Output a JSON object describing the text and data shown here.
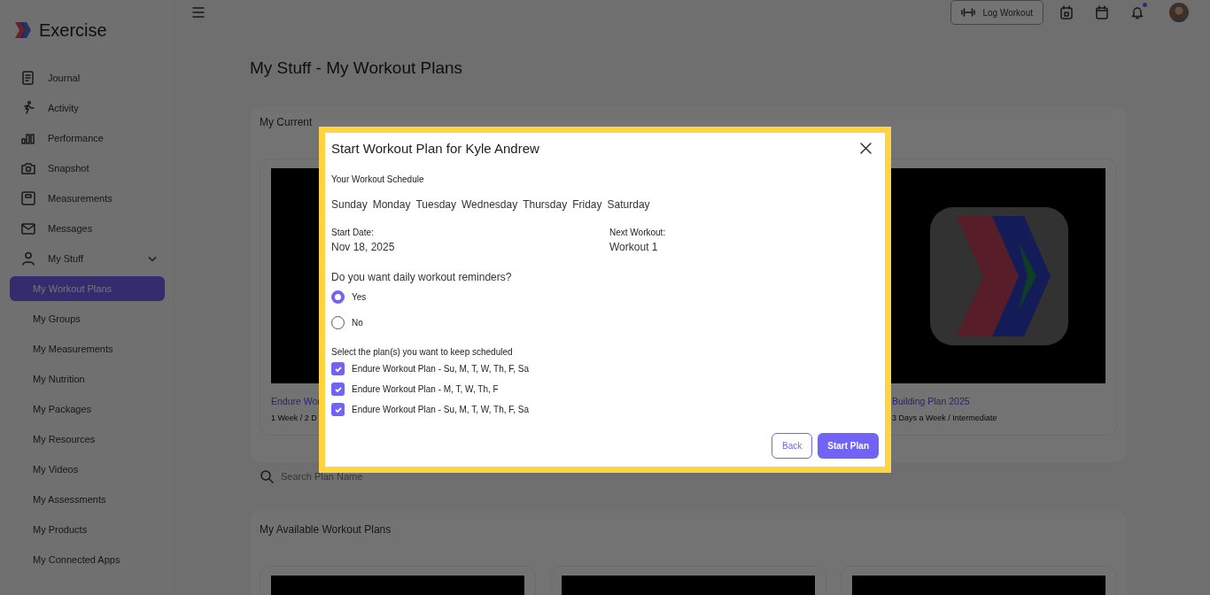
{
  "brand": {
    "name": "Exercise"
  },
  "sidebar": {
    "items": [
      {
        "label": "Journal"
      },
      {
        "label": "Activity"
      },
      {
        "label": "Performance"
      },
      {
        "label": "Snapshot"
      },
      {
        "label": "Measurements"
      },
      {
        "label": "Messages"
      },
      {
        "label": "My Stuff",
        "expanded": true,
        "children": [
          {
            "label": "My Workout Plans",
            "selected": true
          },
          {
            "label": "My Groups",
            "selected": false
          },
          {
            "label": "My Measurements",
            "selected": false
          },
          {
            "label": "My Nutrition",
            "selected": false
          },
          {
            "label": "My Packages",
            "selected": false
          },
          {
            "label": "My Resources",
            "selected": false
          },
          {
            "label": "My Videos",
            "selected": false
          },
          {
            "label": "My Assessments",
            "selected": false
          },
          {
            "label": "My Products",
            "selected": false
          },
          {
            "label": "My Connected Apps",
            "selected": false
          }
        ]
      }
    ]
  },
  "header": {
    "log_workout": "Log Workout",
    "has_notification": true
  },
  "page": {
    "title": "My Stuff - My Workout Plans",
    "current_plans": {
      "heading": "My Current",
      "cards": [
        {
          "kind": "blank",
          "title": "Endure Wor",
          "meta": "1 Week / 2 D"
        },
        {
          "kind": "logo",
          "title": "Building Plan 2025",
          "meta": "3 Days a Week / Intermediate"
        }
      ]
    },
    "search": {
      "placeholder": "Search Plan Name"
    },
    "available_plans": {
      "heading": "My Available Workout Plans"
    }
  },
  "modal": {
    "title": "Start Workout Plan for Kyle Andrew",
    "schedule_label": "Your Workout Schedule",
    "days": [
      "Sunday",
      "Monday",
      "Tuesday",
      "Wednesday",
      "Thursday",
      "Friday",
      "Saturday"
    ],
    "start_date_label": "Start Date:",
    "start_date": "Nov 18, 2025",
    "next_workout_label": "Next Workout:",
    "next_workout": "Workout 1",
    "reminder_question": "Do you want daily workout reminders?",
    "reminder_options": [
      {
        "label": "Yes",
        "selected": true
      },
      {
        "label": "No",
        "selected": false
      }
    ],
    "plans_label": "Select the plan(s) you want to keep scheduled",
    "plans": [
      {
        "label": "Endure Workout Plan - Su, M, T, W, Th, F, Sa",
        "checked": true
      },
      {
        "label": "Endure Workout Plan - M, T, W, Th, F",
        "checked": true
      },
      {
        "label": "Endure Workout Plan - Su, M, T, W, Th, F, Sa",
        "checked": true
      }
    ],
    "back_button": "Back",
    "start_button": "Start Plan"
  }
}
